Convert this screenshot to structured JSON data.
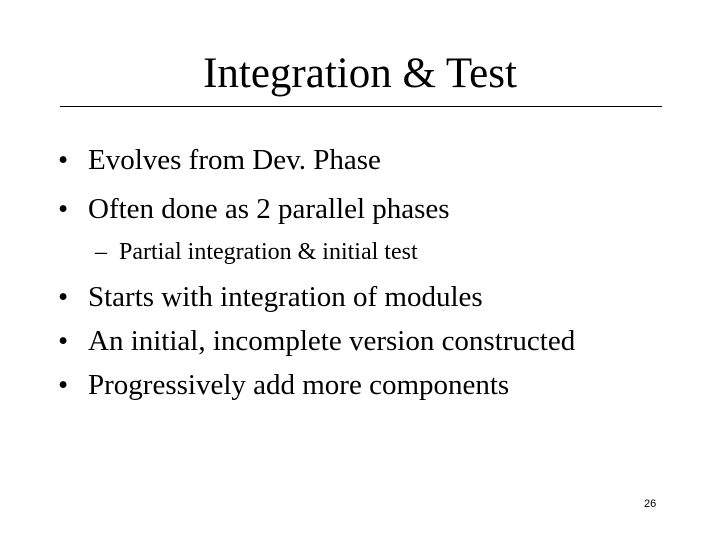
{
  "slide": {
    "title": "Integration & Test",
    "bullets": [
      {
        "marker": "•",
        "text": "Evolves from Dev. Phase"
      },
      {
        "marker": "•",
        "text": "Often done as 2 parallel phases"
      },
      {
        "marker": "–",
        "text": "Partial integration & initial test",
        "level": 2
      },
      {
        "marker": "•",
        "text": "Starts with integration of modules"
      },
      {
        "marker": "•",
        "text": "An initial, incomplete version constructed"
      },
      {
        "marker": "•",
        "text": "Progressively add more components"
      }
    ],
    "page_number": "26"
  }
}
